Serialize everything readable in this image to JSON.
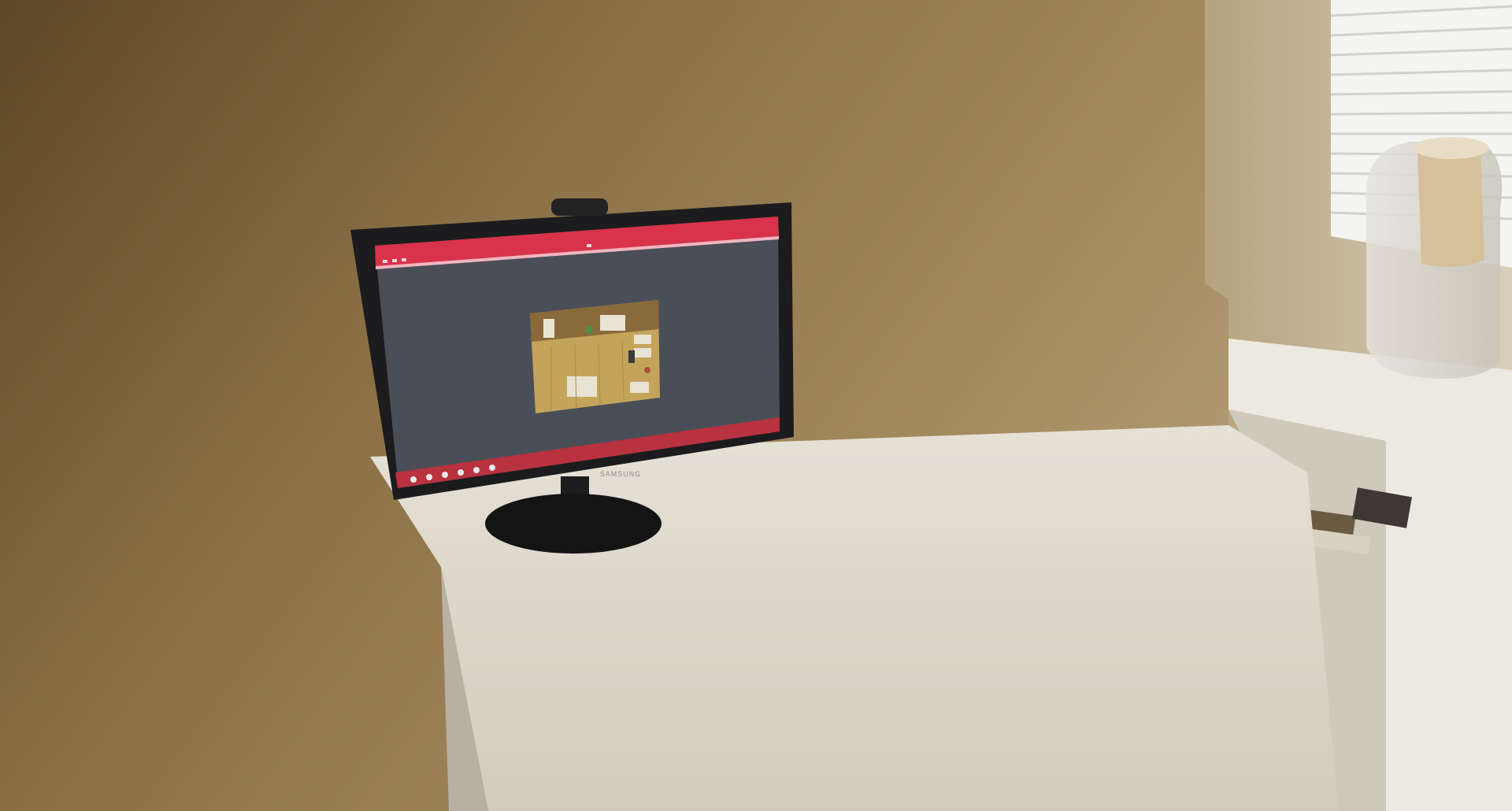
{
  "scene": {
    "description_tag": "photo-two-people-at-dual-monitor-desk",
    "left_monitor": {
      "brand": "SAMSUNG",
      "app": {
        "topbar_color": "#d8334a",
        "canvas_color": "#4a4e57",
        "map_floor_color": "#c4a45b"
      }
    },
    "right_monitor": {
      "screen_color": "#fbfbfb"
    },
    "colors": {
      "wall": "#8d7246",
      "desk": "#e9e5dc",
      "shirt": "#3c3f40",
      "shirt_accent": "#5fe05c"
    }
  }
}
